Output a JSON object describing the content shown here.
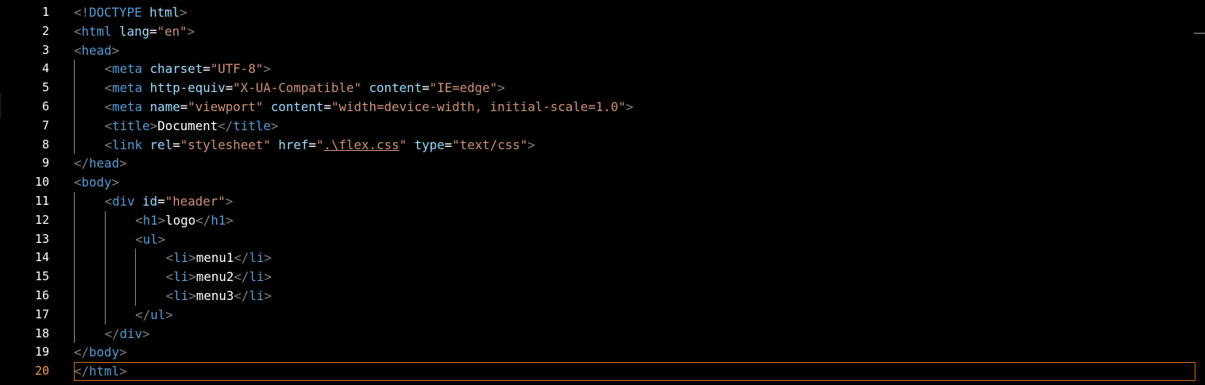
{
  "editor": {
    "active_line": 20,
    "line_numbers": [
      "1",
      "2",
      "3",
      "4",
      "5",
      "6",
      "7",
      "8",
      "9",
      "10",
      "11",
      "12",
      "13",
      "14",
      "15",
      "16",
      "17",
      "18",
      "19",
      "20"
    ],
    "lines": [
      {
        "indent": 0,
        "tokens": [
          [
            "b",
            "<!"
          ],
          [
            "t",
            "DOCTYPE"
          ],
          [
            "txt",
            " "
          ],
          [
            "a",
            "html"
          ],
          [
            "b",
            ">"
          ]
        ]
      },
      {
        "indent": 0,
        "tokens": [
          [
            "b",
            "<"
          ],
          [
            "t",
            "html"
          ],
          [
            "txt",
            " "
          ],
          [
            "a",
            "lang"
          ],
          [
            "txt",
            "="
          ],
          [
            "v",
            "\"en\""
          ],
          [
            "b",
            ">"
          ]
        ]
      },
      {
        "indent": 0,
        "tokens": [
          [
            "b",
            "<"
          ],
          [
            "t",
            "head"
          ],
          [
            "b",
            ">"
          ]
        ]
      },
      {
        "indent": 1,
        "tokens": [
          [
            "b",
            "<"
          ],
          [
            "t",
            "meta"
          ],
          [
            "txt",
            " "
          ],
          [
            "a",
            "charset"
          ],
          [
            "txt",
            "="
          ],
          [
            "v",
            "\"UTF-8\""
          ],
          [
            "b",
            ">"
          ]
        ]
      },
      {
        "indent": 1,
        "tokens": [
          [
            "b",
            "<"
          ],
          [
            "t",
            "meta"
          ],
          [
            "txt",
            " "
          ],
          [
            "a",
            "http-equiv"
          ],
          [
            "txt",
            "="
          ],
          [
            "v",
            "\"X-UA-Compatible\""
          ],
          [
            "txt",
            " "
          ],
          [
            "a",
            "content"
          ],
          [
            "txt",
            "="
          ],
          [
            "v",
            "\"IE=edge\""
          ],
          [
            "b",
            ">"
          ]
        ]
      },
      {
        "indent": 1,
        "tokens": [
          [
            "b",
            "<"
          ],
          [
            "t",
            "meta"
          ],
          [
            "txt",
            " "
          ],
          [
            "a",
            "name"
          ],
          [
            "txt",
            "="
          ],
          [
            "v",
            "\"viewport\""
          ],
          [
            "txt",
            " "
          ],
          [
            "a",
            "content"
          ],
          [
            "txt",
            "="
          ],
          [
            "v",
            "\"width=device-width, initial-scale=1.0\""
          ],
          [
            "b",
            ">"
          ]
        ]
      },
      {
        "indent": 1,
        "tokens": [
          [
            "b",
            "<"
          ],
          [
            "t",
            "title"
          ],
          [
            "b",
            ">"
          ],
          [
            "txt",
            "Document"
          ],
          [
            "b",
            "</"
          ],
          [
            "t",
            "title"
          ],
          [
            "b",
            ">"
          ]
        ]
      },
      {
        "indent": 1,
        "tokens": [
          [
            "b",
            "<"
          ],
          [
            "t",
            "link"
          ],
          [
            "txt",
            " "
          ],
          [
            "a",
            "rel"
          ],
          [
            "txt",
            "="
          ],
          [
            "v",
            "\"stylesheet\""
          ],
          [
            "txt",
            " "
          ],
          [
            "a",
            "href"
          ],
          [
            "txt",
            "="
          ],
          [
            "v",
            "\""
          ],
          [
            "u",
            ".\\flex.css"
          ],
          [
            "v",
            "\""
          ],
          [
            "txt",
            " "
          ],
          [
            "a",
            "type"
          ],
          [
            "txt",
            "="
          ],
          [
            "v",
            "\"text/css\""
          ],
          [
            "b",
            ">"
          ]
        ]
      },
      {
        "indent": 0,
        "tokens": [
          [
            "b",
            "</"
          ],
          [
            "t",
            "head"
          ],
          [
            "b",
            ">"
          ]
        ]
      },
      {
        "indent": 0,
        "tokens": [
          [
            "b",
            "<"
          ],
          [
            "t",
            "body"
          ],
          [
            "b",
            ">"
          ]
        ]
      },
      {
        "indent": 1,
        "tokens": [
          [
            "b",
            "<"
          ],
          [
            "t",
            "div"
          ],
          [
            "txt",
            " "
          ],
          [
            "a",
            "id"
          ],
          [
            "txt",
            "="
          ],
          [
            "v",
            "\"header\""
          ],
          [
            "b",
            ">"
          ]
        ]
      },
      {
        "indent": 2,
        "tokens": [
          [
            "b",
            "<"
          ],
          [
            "t",
            "h1"
          ],
          [
            "b",
            ">"
          ],
          [
            "txt",
            "logo"
          ],
          [
            "b",
            "</"
          ],
          [
            "t",
            "h1"
          ],
          [
            "b",
            ">"
          ]
        ]
      },
      {
        "indent": 2,
        "tokens": [
          [
            "b",
            "<"
          ],
          [
            "t",
            "ul"
          ],
          [
            "b",
            ">"
          ]
        ]
      },
      {
        "indent": 3,
        "tokens": [
          [
            "b",
            "<"
          ],
          [
            "t",
            "li"
          ],
          [
            "b",
            ">"
          ],
          [
            "txt",
            "menu1"
          ],
          [
            "b",
            "</"
          ],
          [
            "t",
            "li"
          ],
          [
            "b",
            ">"
          ]
        ]
      },
      {
        "indent": 3,
        "tokens": [
          [
            "b",
            "<"
          ],
          [
            "t",
            "li"
          ],
          [
            "b",
            ">"
          ],
          [
            "txt",
            "menu2"
          ],
          [
            "b",
            "</"
          ],
          [
            "t",
            "li"
          ],
          [
            "b",
            ">"
          ]
        ]
      },
      {
        "indent": 3,
        "tokens": [
          [
            "b",
            "<"
          ],
          [
            "t",
            "li"
          ],
          [
            "b",
            ">"
          ],
          [
            "txt",
            "menu3"
          ],
          [
            "b",
            "</"
          ],
          [
            "t",
            "li"
          ],
          [
            "b",
            ">"
          ]
        ]
      },
      {
        "indent": 2,
        "tokens": [
          [
            "b",
            "</"
          ],
          [
            "t",
            "ul"
          ],
          [
            "b",
            ">"
          ]
        ]
      },
      {
        "indent": 1,
        "tokens": [
          [
            "b",
            "</"
          ],
          [
            "t",
            "div"
          ],
          [
            "b",
            ">"
          ]
        ]
      },
      {
        "indent": 0,
        "tokens": [
          [
            "b",
            "</"
          ],
          [
            "t",
            "body"
          ],
          [
            "b",
            ">"
          ]
        ]
      },
      {
        "indent": 0,
        "tokens": [
          [
            "b",
            "</"
          ],
          [
            "t",
            "html"
          ],
          [
            "b",
            ">"
          ]
        ]
      }
    ]
  },
  "colors": {
    "background": "#000000",
    "bracket": "#808080",
    "tag": "#569cd6",
    "attribute": "#9cdcfe",
    "string": "#ce9178",
    "text": "#ffffff",
    "active_line_number": "#f0a04b",
    "current_line_border": "#c86f1e"
  }
}
